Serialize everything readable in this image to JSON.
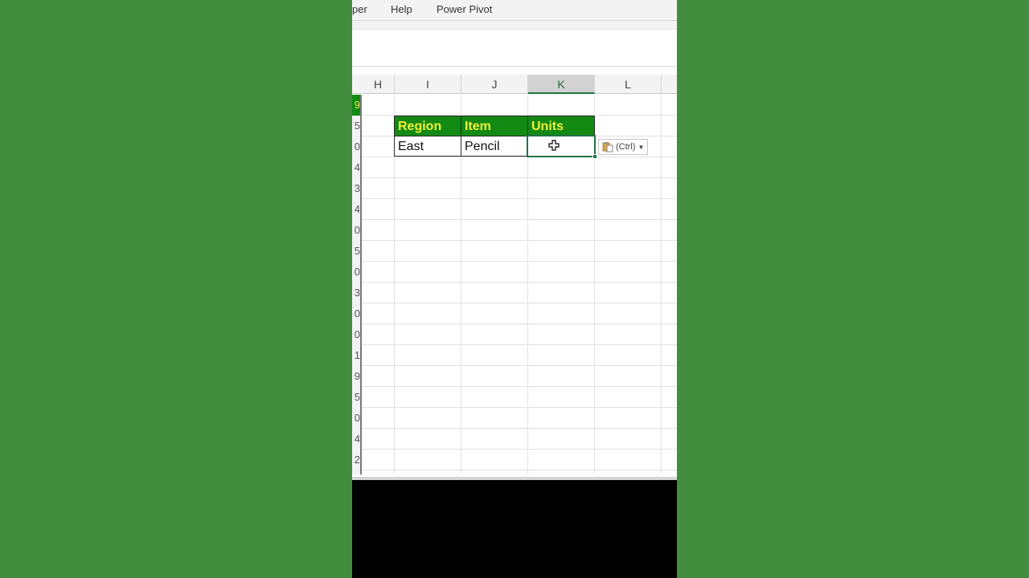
{
  "menu": [
    "per",
    "Help",
    "Power Pivot"
  ],
  "columns": [
    "H",
    "I",
    "J",
    "K",
    "L"
  ],
  "active_column": "K",
  "row_numbers": [
    "9",
    "5",
    "0",
    "4",
    "3",
    "4",
    "0",
    "5",
    "0",
    "3",
    "0",
    "0",
    "1",
    "9",
    "5",
    "0",
    "4",
    "2"
  ],
  "table": {
    "headers": [
      "Region",
      "Item",
      "Units"
    ],
    "row": [
      "East",
      "Pencil",
      ""
    ]
  },
  "paste_options": {
    "label": "(Ctrl)",
    "icon": "clipboard-icon"
  },
  "colors": {
    "header_fill": "#138a13",
    "header_text": "#f0f038",
    "selection": "#217346",
    "background": "#438d3f"
  }
}
